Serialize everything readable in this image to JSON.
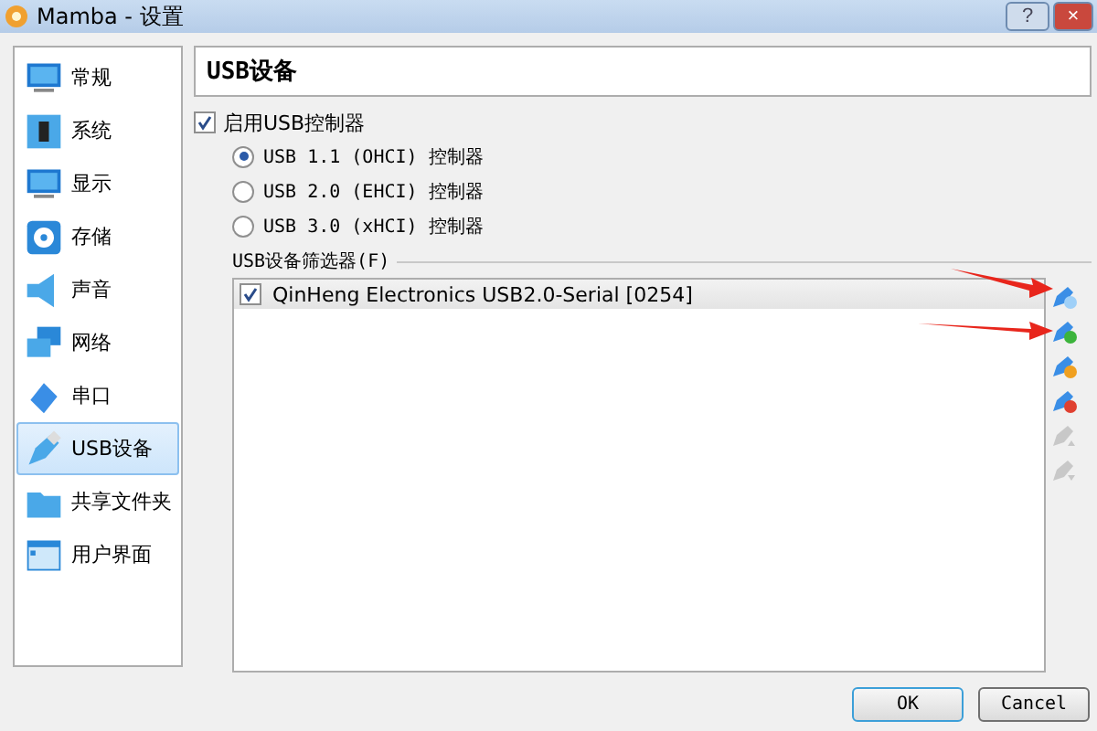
{
  "window": {
    "title": "Mamba - 设置",
    "buttons": [
      {
        "kind": "help",
        "label": "?"
      },
      {
        "kind": "close",
        "label": "×"
      }
    ]
  },
  "sidebar": {
    "items": [
      {
        "label": "常规",
        "selected": false
      },
      {
        "label": "系统",
        "selected": false
      },
      {
        "label": "显示",
        "selected": false
      },
      {
        "label": "存储",
        "selected": false
      },
      {
        "label": "声音",
        "selected": false
      },
      {
        "label": "网络",
        "selected": false
      },
      {
        "label": "串口",
        "selected": false
      },
      {
        "label": "USB设备",
        "selected": true
      },
      {
        "label": "共享文件夹",
        "selected": false
      },
      {
        "label": "用户界面",
        "selected": false
      }
    ]
  },
  "page": {
    "title": "USB设备",
    "enable_usb": {
      "label": "启用USB控制器",
      "checked": true
    },
    "controllers": [
      {
        "label": "USB 1.1 (OHCI) 控制器",
        "selected": true
      },
      {
        "label": "USB 2.0 (EHCI) 控制器",
        "selected": false
      },
      {
        "label": "USB 3.0 (xHCI) 控制器",
        "selected": false
      }
    ],
    "filters_label": "USB设备筛选器(F)",
    "filters": [
      {
        "label": "QinHeng Electronics USB2.0-Serial [0254]",
        "checked": true
      }
    ],
    "filter_tools": [
      {
        "kind": "add-empty",
        "disabled": false
      },
      {
        "kind": "add-device",
        "disabled": false
      },
      {
        "kind": "edit",
        "disabled": false
      },
      {
        "kind": "remove",
        "disabled": false
      },
      {
        "kind": "move-up",
        "disabled": true
      },
      {
        "kind": "move-down",
        "disabled": true
      }
    ]
  },
  "buttons": [
    {
      "label": "OK",
      "default": true
    },
    {
      "label": "Cancel",
      "default": false
    }
  ]
}
